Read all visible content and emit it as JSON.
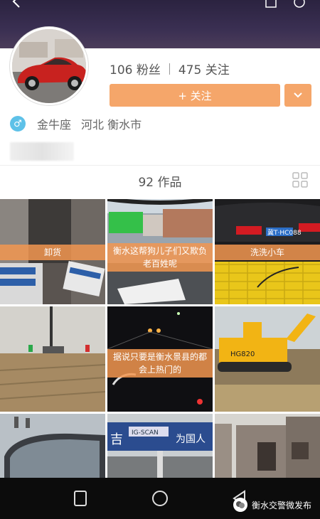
{
  "header": {
    "title": ""
  },
  "profile": {
    "followers": "106 粉丝",
    "following": "475 关注",
    "follow_label": "+ 关注",
    "gender_symbol": "♂",
    "zodiac": "金牛座",
    "location": "河北 衡水市"
  },
  "works": {
    "count_label": "92 作品"
  },
  "tiles": [
    {
      "caption": "卸货"
    },
    {
      "caption": "衡水这帮狗儿子们又欺负老百姓呢"
    },
    {
      "caption": "洗洗小车"
    },
    {
      "caption": ""
    },
    {
      "caption": "据说只要是衡水景县的都会上热门的"
    },
    {
      "caption": ""
    },
    {
      "caption": ""
    },
    {
      "caption": ""
    },
    {
      "caption": ""
    }
  ],
  "scene_text": {
    "excavator_label": "HG820",
    "sign_text": "为国人",
    "sign_text2": "吉",
    "plate": "冀T·HC088",
    "sign_top": "IG-SCAN"
  },
  "watermark": {
    "text": "衡水交警微发布"
  },
  "colors": {
    "accent": "#f5a66a",
    "caption_bg": "#f29650",
    "gender": "#5ec1e8"
  }
}
